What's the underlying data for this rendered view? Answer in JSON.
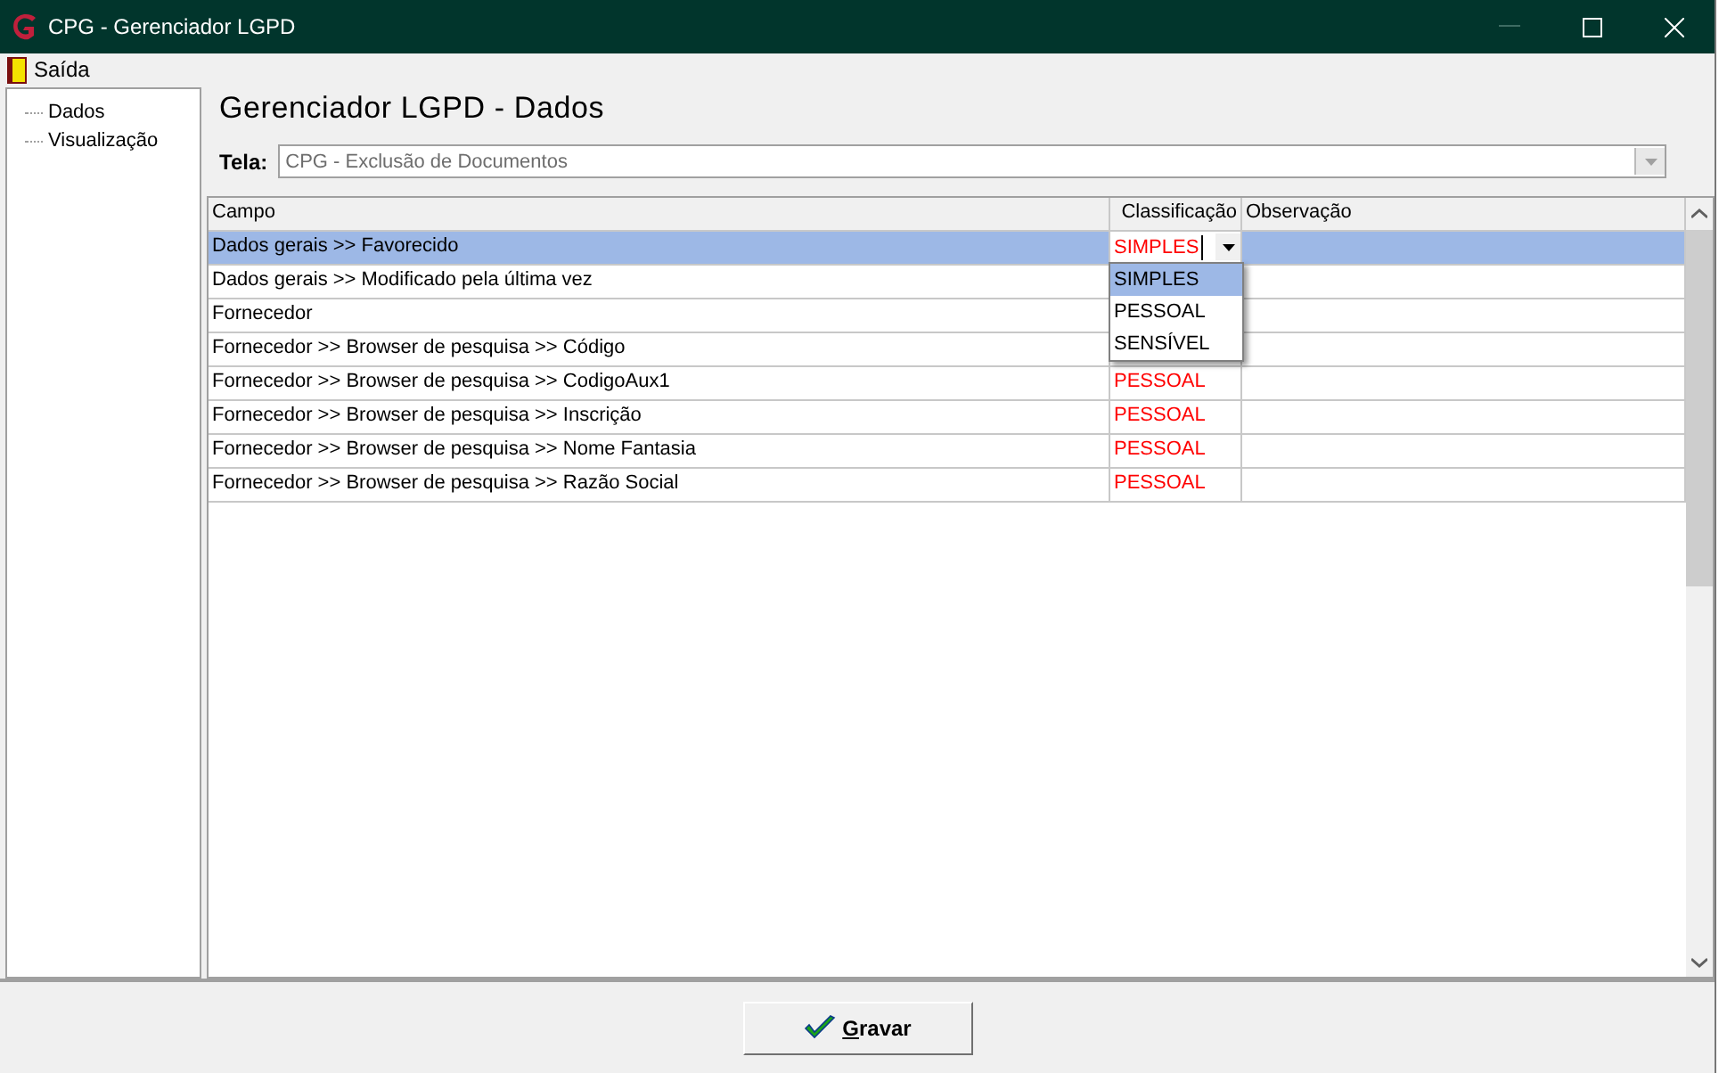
{
  "window": {
    "title": "CPG - Gerenciador LGPD"
  },
  "menu": [
    {
      "label": "Saída"
    }
  ],
  "tree": {
    "items": [
      {
        "label": "Dados"
      },
      {
        "label": "Visualização"
      }
    ]
  },
  "heading": "Gerenciador LGPD - Dados",
  "tela": {
    "label": "Tela:",
    "value": "CPG - Exclusão de Documentos",
    "disabled": true
  },
  "grid": {
    "columns": [
      "Campo",
      "Classificação",
      "Observação"
    ],
    "rows": [
      {
        "campo": "Dados gerais >> Favorecido",
        "classificacao": "SIMPLES",
        "selected": true,
        "editing": true
      },
      {
        "campo": "Dados gerais >> Modificado pela última vez",
        "selected": false,
        "editing": false
      },
      {
        "campo": "Fornecedor",
        "selected": false,
        "editing": false
      },
      {
        "campo": "Fornecedor >> Browser de pesquisa >> Código",
        "selected": false,
        "editing": false
      },
      {
        "campo": "Fornecedor >> Browser de pesquisa >> CodigoAux1",
        "classificacao": "PESSOAL",
        "selected": false,
        "editing": false
      },
      {
        "campo": "Fornecedor >> Browser de pesquisa >> Inscrição",
        "classificacao": "PESSOAL",
        "selected": false,
        "editing": false
      },
      {
        "campo": "Fornecedor >> Browser de pesquisa >> Nome Fantasia",
        "classificacao": "PESSOAL",
        "selected": false,
        "editing": false
      },
      {
        "campo": "Fornecedor >> Browser de pesquisa >> Razão Social",
        "classificacao": "PESSOAL",
        "selected": false,
        "editing": false
      }
    ],
    "dropdown": [
      {
        "label": "SIMPLES",
        "selected": true
      },
      {
        "label": "PESSOAL",
        "selected": false
      },
      {
        "label": "SENSÍVEL",
        "selected": false
      }
    ]
  },
  "button": {
    "label": "Gravar"
  }
}
